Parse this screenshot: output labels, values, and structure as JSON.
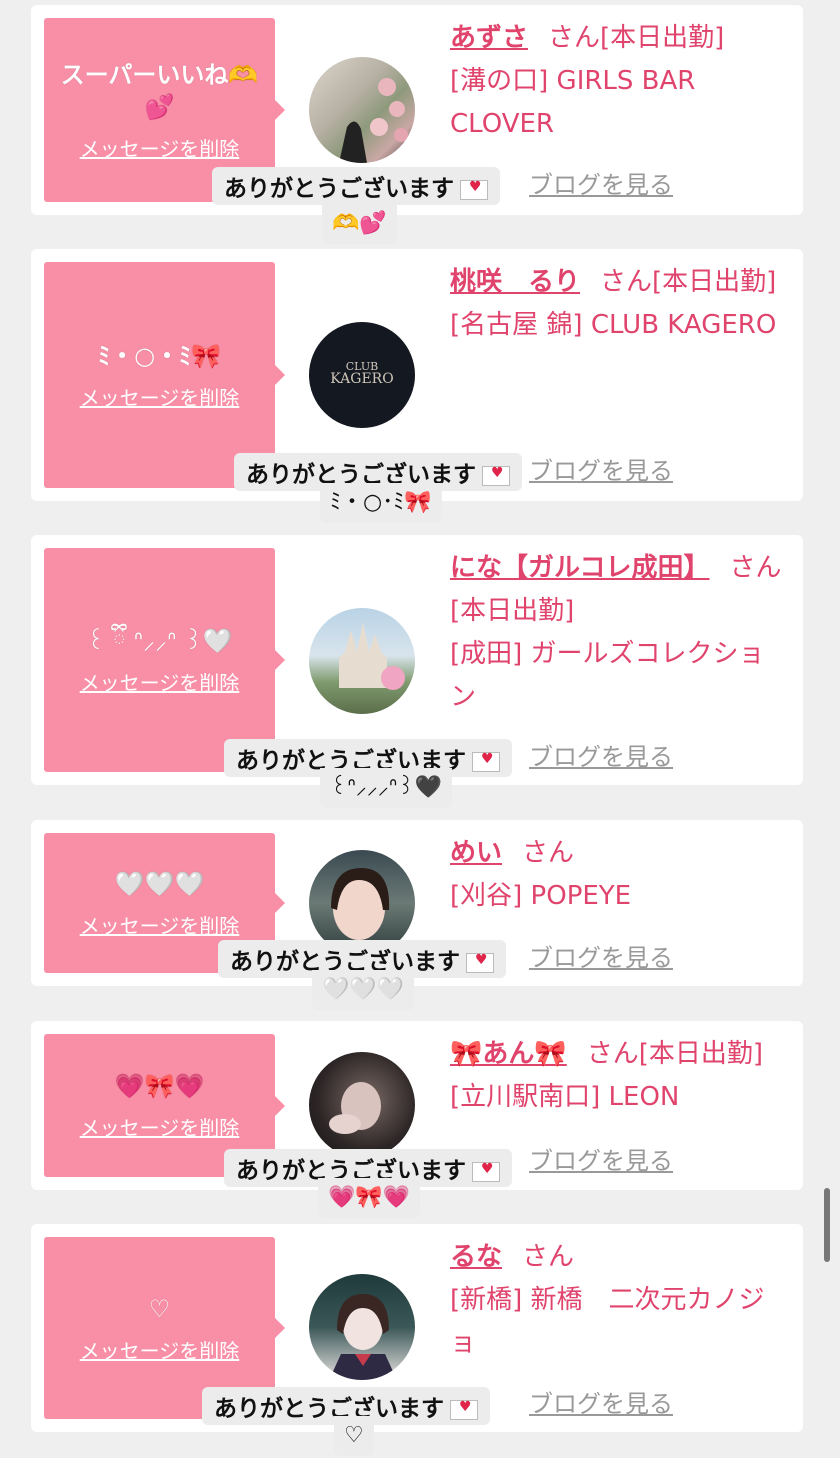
{
  "theme": {
    "accent": "#e0446d",
    "bubble": "#f98fa6",
    "card": "#ffffff",
    "background": "#efefef"
  },
  "cards": [
    {
      "message": "スーパーいいね🫶💕",
      "delete_label": "メッセージを削除",
      "girl_name": "あずさ",
      "san": "さん",
      "status": "[本日出勤]",
      "shop": "[溝の口] GIRLS BAR CLOVER",
      "blog_label": "ブログを見る",
      "reply_text": "ありがとうございます",
      "reply_sub": "🫶💕",
      "avatar_desc": "flower staircase photo"
    },
    {
      "message": "ﾐ・○・ﾐ🎀",
      "delete_label": "メッセージを削除",
      "girl_name": "桃咲　るり",
      "san": "さん",
      "status": "[本日出勤]",
      "shop": "[名古屋 錦] CLUB KAGERO",
      "blog_label": "ブログを見る",
      "reply_text": "ありがとうございます",
      "reply_sub": "ﾐ・○･ﾐ🎀",
      "avatar_desc": "CLUB KAGERO logo",
      "avatar_logo_line1": "CLUB",
      "avatar_logo_line2": "KAGERO"
    },
    {
      "message": "꒰ ྀི ᐢ⸝⸝ᐢ ꒱🤍",
      "delete_label": "メッセージを削除",
      "girl_name": "にな【ガルコレ成田】",
      "san": "さん",
      "status": "[本日出勤]",
      "shop": "[成田] ガールズコレクション",
      "blog_label": "ブログを見る",
      "reply_text": "ありがとうございます",
      "reply_sub": "꒰ᐢ⸝⸝⸝ᐢ꒱🖤",
      "avatar_desc": "castle photo"
    },
    {
      "message": "🤍🤍🤍",
      "delete_label": "メッセージを削除",
      "girl_name": "めい",
      "san": "さん",
      "status": "",
      "shop": "[刈谷] POPEYE",
      "blog_label": "ブログを見る",
      "reply_text": "ありがとうございます",
      "reply_sub": "🤍🤍🤍",
      "avatar_desc": "portrait photo"
    },
    {
      "message": "💗🎀💗",
      "delete_label": "メッセージを削除",
      "girl_name": "🎀あん🎀",
      "san": "さん",
      "status": "[本日出勤]",
      "shop": "[立川駅南口] LEON",
      "blog_label": "ブログを見る",
      "reply_text": "ありがとうございます",
      "reply_sub": "💗🎀💗",
      "avatar_desc": "portrait photo dark"
    },
    {
      "message": "♡",
      "delete_label": "メッセージを削除",
      "girl_name": "るな",
      "san": "さん",
      "status": "",
      "shop": "[新橋] 新橋　二次元カノジョ",
      "blog_label": "ブログを見る",
      "reply_text": "ありがとうございます",
      "reply_sub": "♡",
      "avatar_desc": "portrait photo uniform"
    }
  ]
}
